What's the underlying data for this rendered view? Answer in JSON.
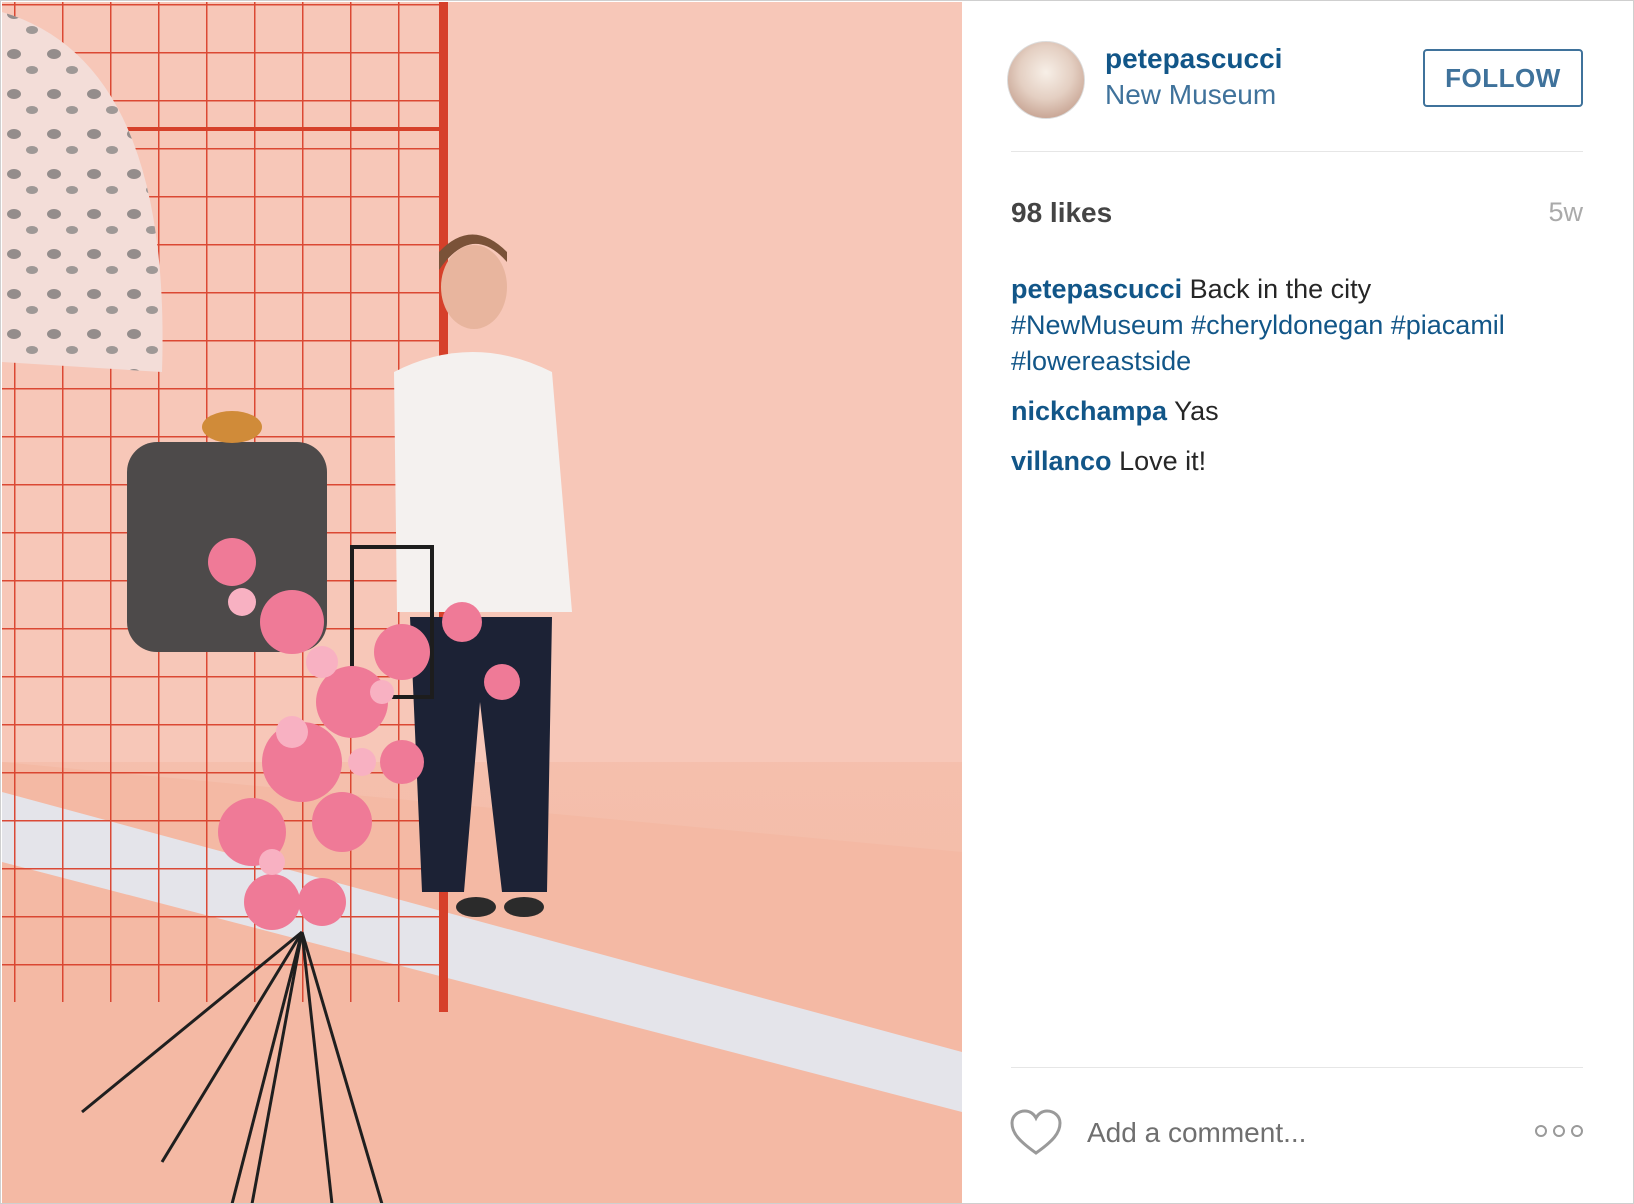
{
  "post": {
    "image_alt": "",
    "owner": {
      "username": "petepascucci",
      "location": "New Museum"
    },
    "follow_label": "FOLLOW",
    "likes_text": "98 likes",
    "age": "5w",
    "caption": {
      "author": "petepascucci",
      "text": "Back in the city",
      "hashtags": [
        "#NewMuseum",
        "#cheryldonegan",
        "#piacamil",
        "#lowereastside"
      ]
    },
    "comments": [
      {
        "author": "nickchampa",
        "text": "Yas"
      },
      {
        "author": "villanco",
        "text": "Love it!"
      }
    ],
    "comment_placeholder": "Add a comment...",
    "icons": {
      "like": "heart-outline-icon",
      "more": "more-options-icon"
    }
  },
  "colors": {
    "username": "#125688",
    "location": "#3f729b",
    "follow_border": "#3f729b",
    "text": "#262626",
    "muted": "#aaaaaa",
    "photo_background": "#f6c4b4",
    "grid": "#d9412c"
  }
}
